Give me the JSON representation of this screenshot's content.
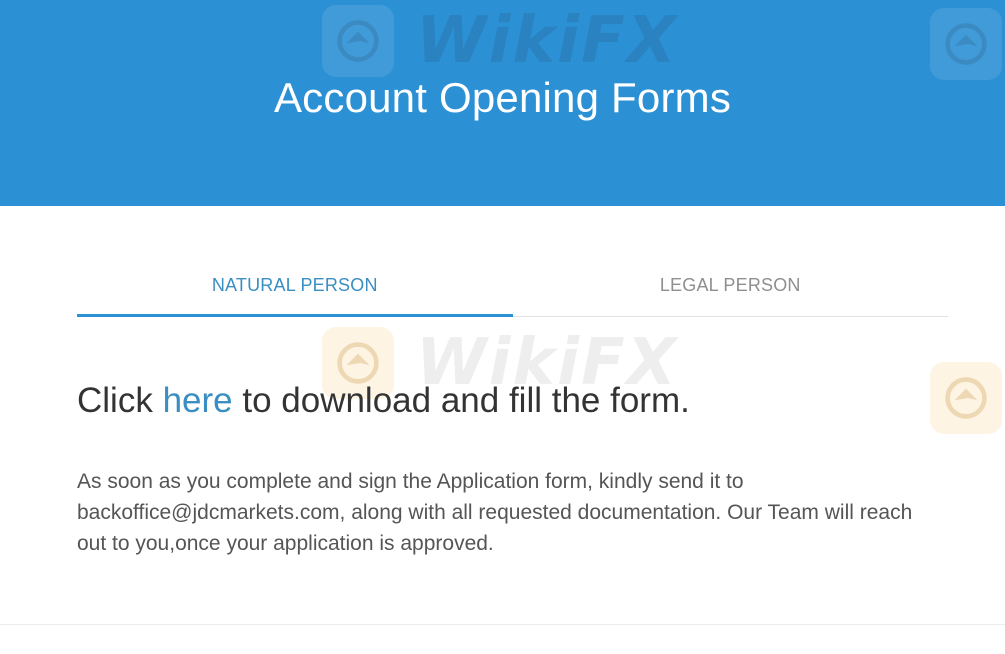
{
  "header": {
    "title": "Account Opening Forms"
  },
  "tabs": [
    {
      "label": "NATURAL PERSON",
      "active": true
    },
    {
      "label": "LEGAL PERSON",
      "active": false
    }
  ],
  "content": {
    "headline_before": "Click ",
    "headline_link": "here",
    "headline_after": " to download and fill the form.",
    "body": "As soon as you complete and sign the Application form, kindly send it to backoffice@jdcmarkets.com, along with all requested documentation. Our Team will reach out to you,once your application is approved."
  },
  "watermark": {
    "text": "WikiFX",
    "icon": "wikifx-logo-icon"
  },
  "colors": {
    "header_bg": "#2b90d4",
    "accent": "#3a8ec2",
    "inactive_tab": "#8f8f8f",
    "text": "#555555"
  }
}
